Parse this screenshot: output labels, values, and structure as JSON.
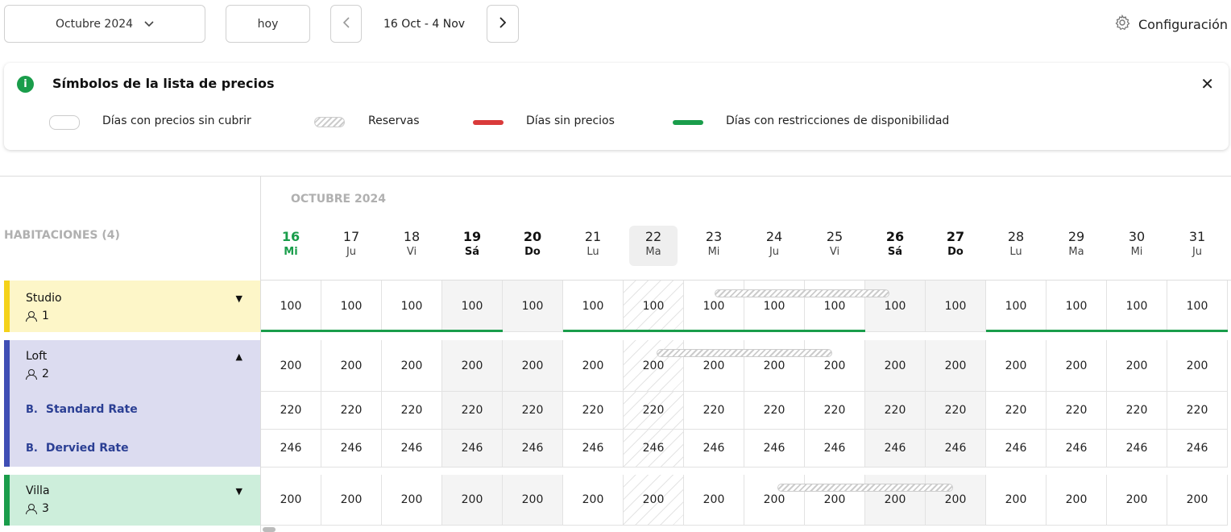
{
  "toolbar": {
    "month": "Octubre 2024",
    "today": "hoy",
    "range": "16 Oct - 4 Nov",
    "config": "Configuración"
  },
  "legend": {
    "title": "Símbolos de la lista de precios",
    "items": {
      "uncovered": "Días con precios sin cubrir",
      "bookings": "Reservas",
      "no_price": "Días sin precios",
      "restrictions": "Días con restricciones de disponibilidad"
    },
    "colors": {
      "info": "#1a9d4b",
      "no_price": "#d93b3b",
      "restrictions": "#1a9d4b"
    }
  },
  "grid": {
    "rooms_header": "HABITACIONES (4)",
    "month_label": "OCTUBRE 2024",
    "days": [
      {
        "num": "16",
        "dow": "Mi"
      },
      {
        "num": "17",
        "dow": "Ju"
      },
      {
        "num": "18",
        "dow": "Vi"
      },
      {
        "num": "19",
        "dow": "Sá"
      },
      {
        "num": "20",
        "dow": "Do"
      },
      {
        "num": "21",
        "dow": "Lu"
      },
      {
        "num": "22",
        "dow": "Ma"
      },
      {
        "num": "23",
        "dow": "Mi"
      },
      {
        "num": "24",
        "dow": "Ju"
      },
      {
        "num": "25",
        "dow": "Vi"
      },
      {
        "num": "26",
        "dow": "Sá"
      },
      {
        "num": "27",
        "dow": "Do"
      },
      {
        "num": "28",
        "dow": "Lu"
      },
      {
        "num": "29",
        "dow": "Ma"
      },
      {
        "num": "30",
        "dow": "Mi"
      },
      {
        "num": "31",
        "dow": "Ju"
      }
    ]
  },
  "rooms": [
    {
      "name": "Studio",
      "capacity": "1",
      "color": "#f4d21a",
      "bg": "#fdf6c8",
      "prices": [
        "100",
        "100",
        "100",
        "100",
        "100",
        "100",
        "100",
        "100",
        "100",
        "100",
        "100",
        "100",
        "100",
        "100",
        "100",
        "100"
      ]
    },
    {
      "name": "Loft",
      "capacity": "2",
      "color": "#3f4eb5",
      "bg": "#dcdcf0",
      "prices": [
        "200",
        "200",
        "200",
        "200",
        "200",
        "200",
        "200",
        "200",
        "200",
        "200",
        "200",
        "200",
        "200",
        "200",
        "200",
        "200"
      ],
      "rates": [
        {
          "name": "Standard Rate",
          "icon": "B.",
          "prices": [
            "220",
            "220",
            "220",
            "220",
            "220",
            "220",
            "220",
            "220",
            "220",
            "220",
            "220",
            "220",
            "220",
            "220",
            "220",
            "220"
          ]
        },
        {
          "name": "Dervied Rate",
          "icon": "B.",
          "prices": [
            "246",
            "246",
            "246",
            "246",
            "246",
            "246",
            "246",
            "246",
            "246",
            "246",
            "246",
            "246",
            "246",
            "246",
            "246",
            "246"
          ]
        }
      ]
    },
    {
      "name": "Villa",
      "capacity": "3",
      "color": "#1a9d4b",
      "bg": "#cdeedb",
      "prices": [
        "200",
        "200",
        "200",
        "200",
        "200",
        "200",
        "200",
        "200",
        "200",
        "200",
        "200",
        "200",
        "200",
        "200",
        "200",
        "200"
      ]
    }
  ]
}
